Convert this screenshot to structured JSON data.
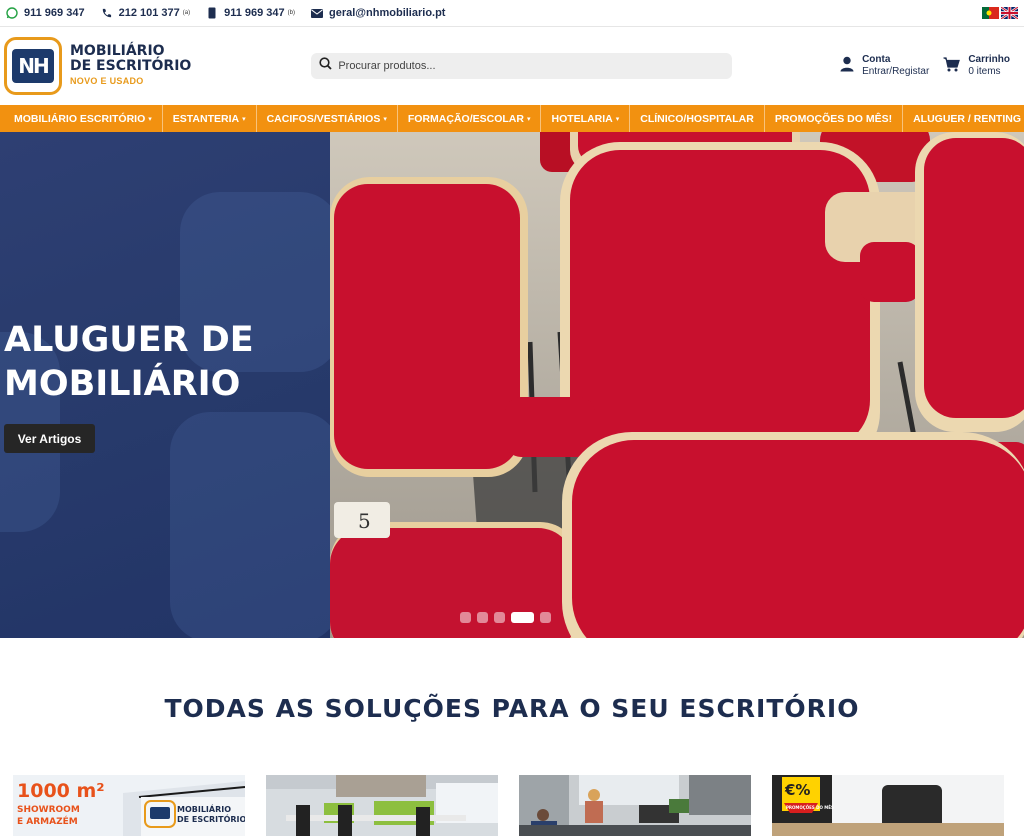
{
  "topbar": {
    "whatsapp": "911 969 347",
    "phone1": "212 101 377",
    "phone1_note": "(a)",
    "phone2": "911 969 347",
    "phone2_note": "(b)",
    "email": "geral@nhmobiliario.pt"
  },
  "logo": {
    "mark": "NH",
    "line1": "MOBILIÁRIO",
    "line2": "DE ESCRITÓRIO",
    "line3": "NOVO E USADO"
  },
  "search": {
    "placeholder": "Procurar produtos..."
  },
  "account": {
    "title": "Conta",
    "subtitle": "Entrar/Registar"
  },
  "cart": {
    "title": "Carrinho",
    "count": "0 items"
  },
  "nav": [
    {
      "label": "MOBILIÁRIO ESCRITÓRIO",
      "caret": true
    },
    {
      "label": "ESTANTERIA",
      "caret": true
    },
    {
      "label": "CACIFOS/VESTIÁRIOS",
      "caret": true
    },
    {
      "label": "FORMAÇÃO/ESCOLAR",
      "caret": true
    },
    {
      "label": "HOTELARIA",
      "caret": true
    },
    {
      "label": "CLÍNICO/HOSPITALAR",
      "caret": false
    },
    {
      "label": "PROMOÇÕES DO MÊS!",
      "caret": false
    },
    {
      "label": "ALUGUER / RENTING",
      "caret": false
    }
  ],
  "hero": {
    "title_line1": "ALUGUER DE",
    "title_line2": "MOBILIÁRIO",
    "button": "Ver Artigos",
    "slides": 5,
    "active_slide": 4,
    "seat_number": "5"
  },
  "section": {
    "title": "TODAS AS SOLUÇÕES PARA O SEU ESCRITÓRIO"
  },
  "cards": {
    "card1_big": "1000 m²",
    "card1_small1": "SHOWROOM",
    "card1_small2": "E ARMAZÉM",
    "card1_sign1": "MOBILIÁRIO",
    "card1_sign2": "DE ESCRITÓRIO",
    "card4_badge": "€%",
    "card4_badge_sub": "PROMOÇÕES DO MÊS"
  },
  "colors": {
    "accent": "#f29110",
    "navy": "#1d2d4f",
    "hero_blue": "#283b6c",
    "chair_red": "#c8102e"
  }
}
